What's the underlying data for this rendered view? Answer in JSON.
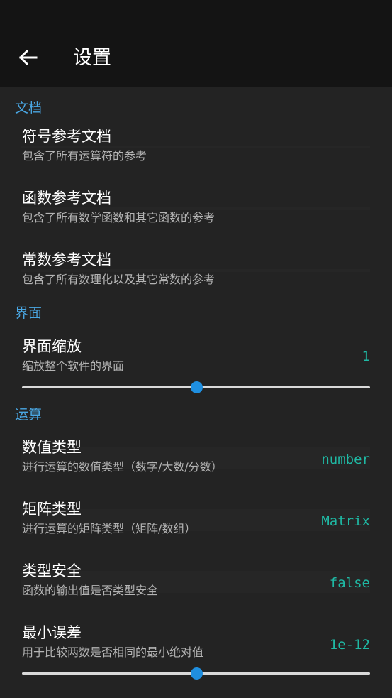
{
  "app_bar": {
    "title": "设置",
    "back_icon": "arrow-left-icon"
  },
  "sections": {
    "docs": {
      "header": "文档",
      "items": [
        {
          "title": "符号参考文档",
          "summary": "包含了所有运算符的参考"
        },
        {
          "title": "函数参考文档",
          "summary": "包含了所有数学函数和其它函数的参考"
        },
        {
          "title": "常数参考文档",
          "summary": "包含了所有数理化以及其它常数的参考"
        }
      ]
    },
    "ui": {
      "header": "界面",
      "scale": {
        "title": "界面缩放",
        "summary": "缩放整个软件的界面",
        "value": "1",
        "slider_fraction": 0.5
      }
    },
    "calc": {
      "header": "运算",
      "items": [
        {
          "title": "数值类型",
          "summary": "进行运算的数值类型（数字/大数/分数）",
          "value": "number"
        },
        {
          "title": "矩阵类型",
          "summary": "进行运算的矩阵类型（矩阵/数组）",
          "value": "Matrix"
        },
        {
          "title": "类型安全",
          "summary": "函数的输出值是否类型安全",
          "value": "false"
        }
      ],
      "epsilon": {
        "title": "最小误差",
        "summary": "用于比较两数是否相同的最小绝对值",
        "value": "1e-12",
        "slider_fraction": 0.5
      }
    }
  },
  "colors": {
    "accent": "#4aa7e3",
    "value": "#1fb9a4",
    "slider_thumb": "#1f8fe0",
    "background": "#232323",
    "app_bar": "#141414"
  }
}
